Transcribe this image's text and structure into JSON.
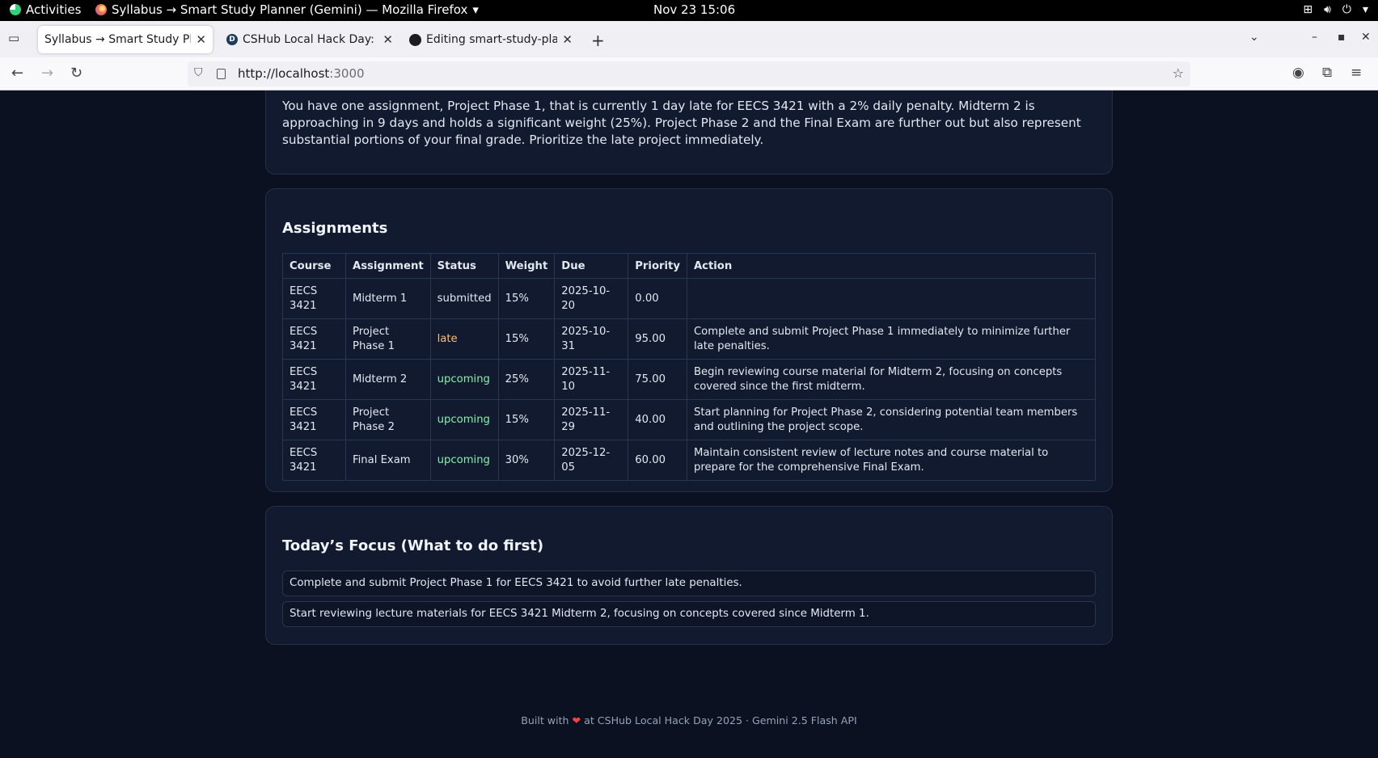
{
  "system_bar": {
    "activities": "Activities",
    "app_title": "Syllabus → Smart Study Planner (Gemini) — Mozilla Firefox",
    "clock": "Nov 23  15:06"
  },
  "tabs": [
    {
      "title": "Syllabus → Smart Study Planner",
      "active": true
    },
    {
      "title": "CSHub Local Hack Day: CS",
      "active": false
    },
    {
      "title": "Editing smart-study-planner",
      "active": false
    }
  ],
  "url": {
    "host": "http://localhost",
    "port": ":3000"
  },
  "summary": {
    "text": "You have one assignment, Project Phase 1, that is currently 1 day late for EECS 3421 with a 2% daily penalty. Midterm 2 is approaching in 9 days and holds a significant weight (25%). Project Phase 2 and the Final Exam are further out but also represent substantial portions of your final grade. Prioritize the late project immediately."
  },
  "assignments": {
    "title": "Assignments",
    "columns": [
      "Course",
      "Assignment",
      "Status",
      "Weight",
      "Due",
      "Priority",
      "Action"
    ],
    "rows": [
      {
        "course": "EECS 3421",
        "assignment": "Midterm 1",
        "status": "submitted",
        "weight": "15%",
        "due": "2025-10-20",
        "priority": "0.00",
        "action": ""
      },
      {
        "course": "EECS 3421",
        "assignment": "Project Phase 1",
        "status": "late",
        "weight": "15%",
        "due": "2025-10-31",
        "priority": "95.00",
        "action": "Complete and submit Project Phase 1 immediately to minimize further late penalties."
      },
      {
        "course": "EECS 3421",
        "assignment": "Midterm 2",
        "status": "upcoming",
        "weight": "25%",
        "due": "2025-11-10",
        "priority": "75.00",
        "action": "Begin reviewing course material for Midterm 2, focusing on concepts covered since the first midterm."
      },
      {
        "course": "EECS 3421",
        "assignment": "Project Phase 2",
        "status": "upcoming",
        "weight": "15%",
        "due": "2025-11-29",
        "priority": "40.00",
        "action": "Start planning for Project Phase 2, considering potential team members and outlining the project scope."
      },
      {
        "course": "EECS 3421",
        "assignment": "Final Exam",
        "status": "upcoming",
        "weight": "30%",
        "due": "2025-12-05",
        "priority": "60.00",
        "action": "Maintain consistent review of lecture notes and course material to prepare for the comprehensive Final Exam."
      }
    ]
  },
  "focus": {
    "title": "Today’s Focus (What to do first)",
    "items": [
      "Complete and submit Project Phase 1 for EECS 3421 to avoid further late penalties.",
      "Start reviewing lecture materials for EECS 3421 Midterm 2, focusing on concepts covered since Midterm 1."
    ]
  },
  "footer": {
    "prefix": "Built with",
    "suffix": "at CSHub Local Hack Day 2025 · Gemini 2.5 Flash API"
  },
  "colors": {
    "background": "#0b1120",
    "card": "#111a2e",
    "status_late": "#fbbf75",
    "status_upcoming": "#86efac"
  }
}
